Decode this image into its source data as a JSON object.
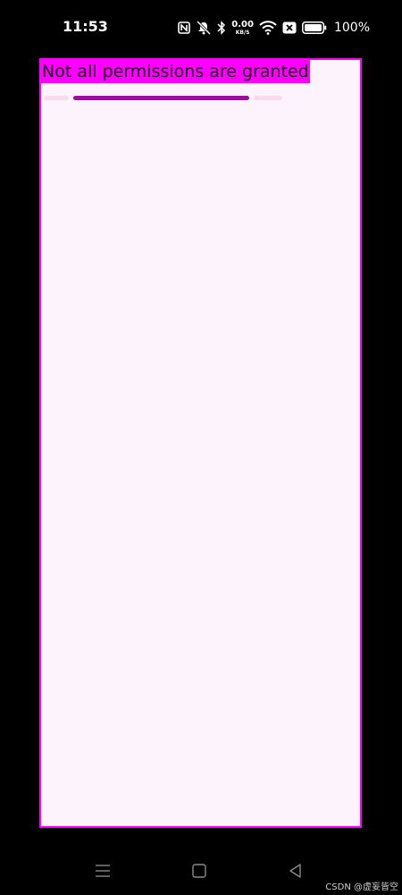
{
  "status_bar": {
    "time": "11:53",
    "net_speed_value": "0.00",
    "net_speed_unit": "KB/S",
    "battery_percent": "100%",
    "icons": [
      "nfc-icon",
      "mute-icon",
      "bluetooth-icon",
      "network-speed",
      "wifi-icon",
      "sim-blocked-icon",
      "battery-icon"
    ]
  },
  "app": {
    "title": "Not all permissions are granted",
    "page_indicator": {
      "pages": 3,
      "active_index": 1
    },
    "colors": {
      "surface": "#fdf3fd",
      "border": "#ff00ff",
      "title_background": "#ff00ff",
      "indicator_active": "#a10aa1",
      "indicator_inactive": "#fbd9ea"
    }
  },
  "nav_bar": {
    "buttons": [
      "menu-icon",
      "home-icon",
      "back-icon"
    ]
  },
  "watermark": "CSDN @虚妄皆空"
}
